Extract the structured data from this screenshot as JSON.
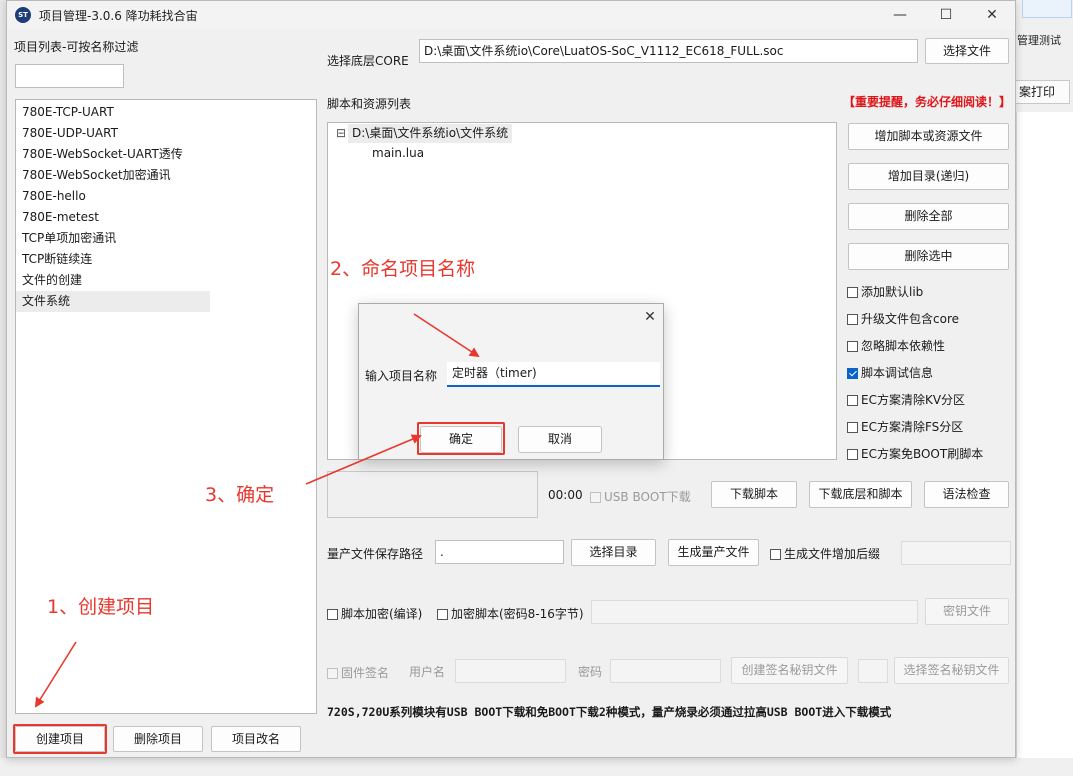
{
  "window": {
    "title": "项目管理-3.0.6 降功耗找合宙",
    "app_icon_text": "ST",
    "controls": {
      "minimize": "—",
      "maximize": "☐",
      "close": "✕"
    }
  },
  "background": {
    "right_label": "管理测试",
    "right_button": "案打印"
  },
  "left_panel": {
    "filter_label": "项目列表-可按名称过滤",
    "filter_value": "",
    "projects": [
      "780E-TCP-UART",
      "780E-UDP-UART",
      "780E-WebSocket-UART透传",
      "780E-WebSocket加密通讯",
      "780E-hello",
      "780E-metest",
      "TCP单项加密通讯",
      "TCP断链续连",
      "文件的创建",
      "文件系统"
    ],
    "selected_index": 9,
    "buttons": {
      "create": "创建项目",
      "delete": "删除项目",
      "rename": "项目改名"
    }
  },
  "core": {
    "label": "选择底层CORE",
    "path": "D:\\桌面\\文件系统io\\Core\\LuatOS-SoC_V1112_EC618_FULL.soc",
    "button": "选择文件"
  },
  "scripts": {
    "label": "脚本和资源列表",
    "warning": "【重要提醒，务必仔细阅读！】",
    "tree_expander": "⊟",
    "tree_root": "D:\\桌面\\文件系统io\\文件系统",
    "tree_children": [
      "main.lua"
    ]
  },
  "side_buttons": {
    "add_script": "增加脚本或资源文件",
    "add_dir": "增加目录(递归)",
    "delete_all": "删除全部",
    "delete_selected": "删除选中"
  },
  "options": [
    {
      "label": "添加默认lib",
      "checked": false
    },
    {
      "label": "升级文件包含core",
      "checked": false
    },
    {
      "label": "忽略脚本依赖性",
      "checked": false
    },
    {
      "label": "脚本调试信息",
      "checked": true
    },
    {
      "label": "EC方案清除KV分区",
      "checked": false
    },
    {
      "label": "EC方案清除FS分区",
      "checked": false
    },
    {
      "label": "EC方案免BOOT刷脚本",
      "checked": false
    }
  ],
  "download": {
    "time": "00:00",
    "usb_boot": "USB BOOT下载",
    "download_script": "下载脚本",
    "download_core_script": "下载底层和脚本",
    "syntax_check": "语法检查"
  },
  "production": {
    "label": "量产文件保存路径",
    "path": ".",
    "choose_dir": "选择目录",
    "generate": "生成量产文件",
    "suffix_option": "生成文件增加后缀"
  },
  "encryption": {
    "script_encrypt": "脚本加密(编译)",
    "encrypt_script": "加密脚本(密码8-16字节)",
    "key_file": "密钥文件"
  },
  "signing": {
    "firmware_sign": "固件签名",
    "username_label": "用户名",
    "password_label": "密码",
    "create_key": "创建签名秘钥文件",
    "choose_key": "选择签名秘钥文件"
  },
  "bottom_note": "720S,720U系列模块有USB BOOT下载和免BOOT下载2种模式，量产烧录必须通过拉高USB BOOT进入下载模式",
  "dialog": {
    "close": "✕",
    "label": "输入项目名称",
    "value": "定时器（timer)",
    "ok": "确定",
    "cancel": "取消"
  },
  "annotations": {
    "step1": "1、创建项目",
    "step2": "2、命名项目名称",
    "step3": "3、确定",
    "color": "#e8372d"
  },
  "colors": {
    "accent": "#0a63c9",
    "warning": "#e0161a"
  }
}
